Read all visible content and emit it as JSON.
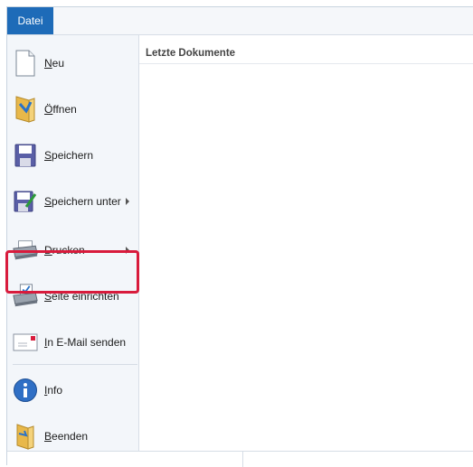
{
  "ribbon": {
    "file_tab_label": "Datei"
  },
  "recent": {
    "header": "Letzte Dokumente"
  },
  "menu": {
    "items": [
      {
        "label": "Neu",
        "icon": "new-document-icon",
        "has_submenu": false
      },
      {
        "label": "Öffnen",
        "icon": "open-folder-icon",
        "has_submenu": false
      },
      {
        "label": "Speichern",
        "icon": "save-disk-icon",
        "has_submenu": false
      },
      {
        "label": "Speichern unter",
        "icon": "save-as-icon",
        "has_submenu": true
      },
      {
        "label": "Drucken",
        "icon": "printer-icon",
        "has_submenu": true,
        "highlighted": true
      },
      {
        "label": "Seite einrichten",
        "icon": "page-setup-icon",
        "has_submenu": false
      },
      {
        "label": "In E-Mail senden",
        "icon": "email-icon",
        "has_submenu": false
      },
      {
        "label": "Info",
        "icon": "info-icon",
        "has_submenu": false
      },
      {
        "label": "Beenden",
        "icon": "exit-icon",
        "has_submenu": false
      }
    ]
  },
  "colors": {
    "accent": "#1e6bb8",
    "highlight": "#d81b3c"
  }
}
